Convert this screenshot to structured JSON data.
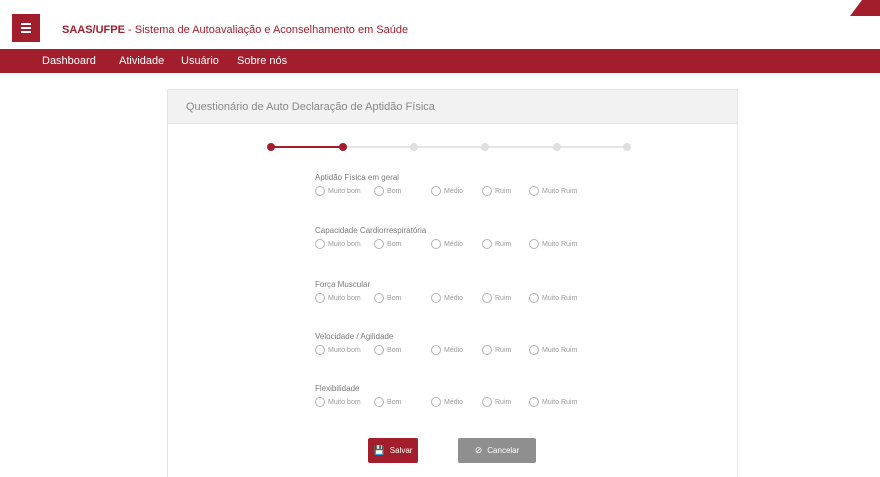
{
  "header": {
    "app_short": "SAAS/UFPE",
    "app_full": " - Sistema de Autoavaliação e Aconselhamento em Saúde",
    "menu_icon": "hamburger-menu-icon",
    "accent_color": "#a31e2c"
  },
  "nav": {
    "items": [
      "Dashboard",
      "Atividade",
      "Usuário",
      "Sobre nós"
    ]
  },
  "card": {
    "title": "Questionário de Auto Declaração de Aptidão Física"
  },
  "stepper": {
    "total_steps": 6,
    "current_step": 2
  },
  "questions": [
    {
      "label": "Aptidão Física em geral"
    },
    {
      "label": "Capacidade Cardiorrespiratória"
    },
    {
      "label": "Força Muscular"
    },
    {
      "label": "Velocidade / Agilidade"
    },
    {
      "label": "Flexibilidade"
    }
  ],
  "options": [
    "Muito bom",
    "Bom",
    "Médio",
    "Ruim",
    "Muito Ruim"
  ],
  "buttons": {
    "save": "Salvar",
    "save_icon": "save-icon",
    "cancel": "Cancelar",
    "cancel_icon": "cancel-icon"
  }
}
